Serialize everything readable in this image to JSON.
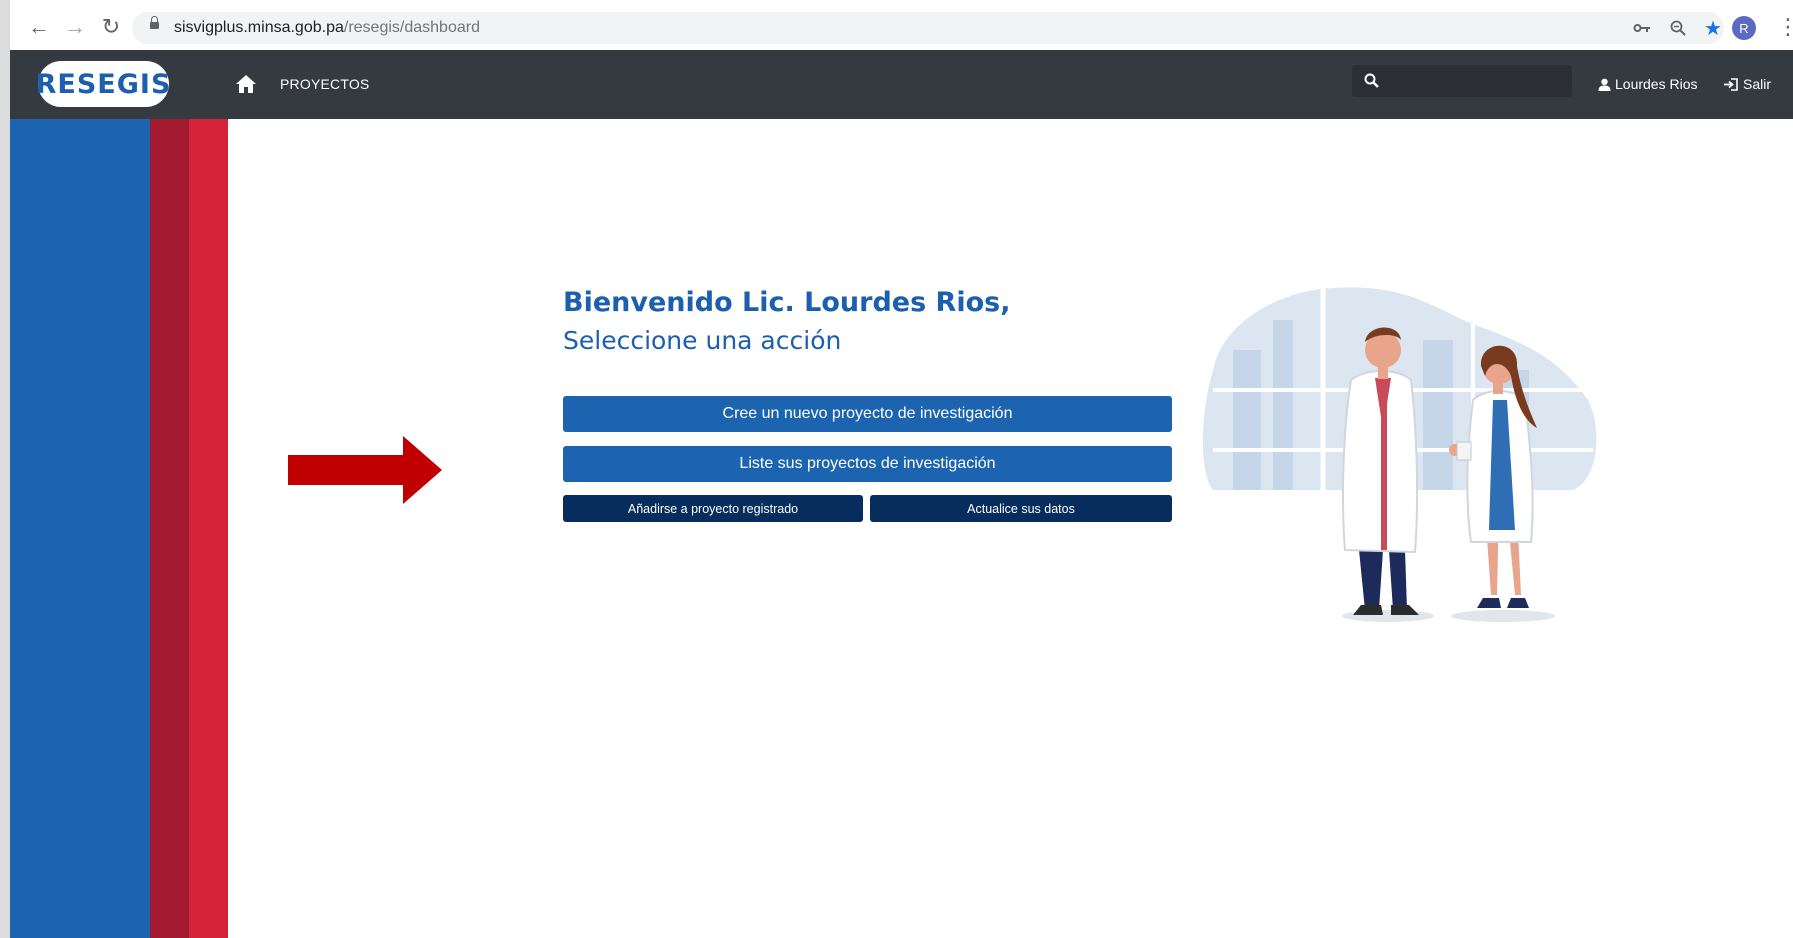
{
  "browser": {
    "url_host": "sisvigplus.minsa.gob.pa",
    "url_path": "/resegis/dashboard",
    "profile_initial": "R",
    "icons": [
      "back-arrow-icon",
      "forward-arrow-icon",
      "reload-icon",
      "lock-icon",
      "key-icon",
      "zoom-icon",
      "star-icon",
      "menu-dots-icon"
    ]
  },
  "navbar": {
    "logo_text": "RESEGIS",
    "projects_link": "PROYECTOS",
    "search_placeholder": "",
    "user_name": "Lourdes Rios",
    "logout_label": "Salir"
  },
  "main": {
    "welcome_title": "Bienvenido Lic. Lourdes Rios,",
    "welcome_subtitle": "Seleccione una acción",
    "buttons": {
      "create": "Cree un nuevo proyecto de investigación",
      "list": "Liste sus proyectos de investigación",
      "join": "Añadirse a proyecto registrado",
      "update": "Actualice sus datos"
    }
  },
  "colors": {
    "navbar": "#343a40",
    "primary_blue": "#1c64b0",
    "dark_blue": "#072d5f",
    "stripe_dark_red": "#a31a30",
    "stripe_red": "#d52439",
    "arrow_red": "#c00000"
  }
}
